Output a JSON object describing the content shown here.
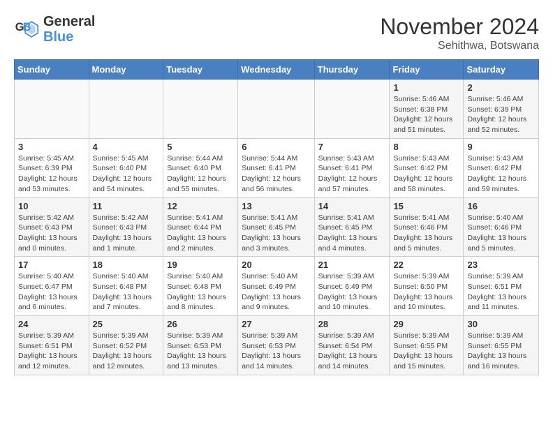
{
  "header": {
    "logo_line1": "General",
    "logo_line2": "Blue",
    "month": "November 2024",
    "location": "Sehithwa, Botswana"
  },
  "weekdays": [
    "Sunday",
    "Monday",
    "Tuesday",
    "Wednesday",
    "Thursday",
    "Friday",
    "Saturday"
  ],
  "weeks": [
    [
      {
        "day": "",
        "info": ""
      },
      {
        "day": "",
        "info": ""
      },
      {
        "day": "",
        "info": ""
      },
      {
        "day": "",
        "info": ""
      },
      {
        "day": "",
        "info": ""
      },
      {
        "day": "1",
        "info": "Sunrise: 5:46 AM\nSunset: 6:38 PM\nDaylight: 12 hours\nand 51 minutes."
      },
      {
        "day": "2",
        "info": "Sunrise: 5:46 AM\nSunset: 6:39 PM\nDaylight: 12 hours\nand 52 minutes."
      }
    ],
    [
      {
        "day": "3",
        "info": "Sunrise: 5:45 AM\nSunset: 6:39 PM\nDaylight: 12 hours\nand 53 minutes."
      },
      {
        "day": "4",
        "info": "Sunrise: 5:45 AM\nSunset: 6:40 PM\nDaylight: 12 hours\nand 54 minutes."
      },
      {
        "day": "5",
        "info": "Sunrise: 5:44 AM\nSunset: 6:40 PM\nDaylight: 12 hours\nand 55 minutes."
      },
      {
        "day": "6",
        "info": "Sunrise: 5:44 AM\nSunset: 6:41 PM\nDaylight: 12 hours\nand 56 minutes."
      },
      {
        "day": "7",
        "info": "Sunrise: 5:43 AM\nSunset: 6:41 PM\nDaylight: 12 hours\nand 57 minutes."
      },
      {
        "day": "8",
        "info": "Sunrise: 5:43 AM\nSunset: 6:42 PM\nDaylight: 12 hours\nand 58 minutes."
      },
      {
        "day": "9",
        "info": "Sunrise: 5:43 AM\nSunset: 6:42 PM\nDaylight: 12 hours\nand 59 minutes."
      }
    ],
    [
      {
        "day": "10",
        "info": "Sunrise: 5:42 AM\nSunset: 6:43 PM\nDaylight: 13 hours\nand 0 minutes."
      },
      {
        "day": "11",
        "info": "Sunrise: 5:42 AM\nSunset: 6:43 PM\nDaylight: 13 hours\nand 1 minute."
      },
      {
        "day": "12",
        "info": "Sunrise: 5:41 AM\nSunset: 6:44 PM\nDaylight: 13 hours\nand 2 minutes."
      },
      {
        "day": "13",
        "info": "Sunrise: 5:41 AM\nSunset: 6:45 PM\nDaylight: 13 hours\nand 3 minutes."
      },
      {
        "day": "14",
        "info": "Sunrise: 5:41 AM\nSunset: 6:45 PM\nDaylight: 13 hours\nand 4 minutes."
      },
      {
        "day": "15",
        "info": "Sunrise: 5:41 AM\nSunset: 6:46 PM\nDaylight: 13 hours\nand 5 minutes."
      },
      {
        "day": "16",
        "info": "Sunrise: 5:40 AM\nSunset: 6:46 PM\nDaylight: 13 hours\nand 5 minutes."
      }
    ],
    [
      {
        "day": "17",
        "info": "Sunrise: 5:40 AM\nSunset: 6:47 PM\nDaylight: 13 hours\nand 6 minutes."
      },
      {
        "day": "18",
        "info": "Sunrise: 5:40 AM\nSunset: 6:48 PM\nDaylight: 13 hours\nand 7 minutes."
      },
      {
        "day": "19",
        "info": "Sunrise: 5:40 AM\nSunset: 6:48 PM\nDaylight: 13 hours\nand 8 minutes."
      },
      {
        "day": "20",
        "info": "Sunrise: 5:40 AM\nSunset: 6:49 PM\nDaylight: 13 hours\nand 9 minutes."
      },
      {
        "day": "21",
        "info": "Sunrise: 5:39 AM\nSunset: 6:49 PM\nDaylight: 13 hours\nand 10 minutes."
      },
      {
        "day": "22",
        "info": "Sunrise: 5:39 AM\nSunset: 6:50 PM\nDaylight: 13 hours\nand 10 minutes."
      },
      {
        "day": "23",
        "info": "Sunrise: 5:39 AM\nSunset: 6:51 PM\nDaylight: 13 hours\nand 11 minutes."
      }
    ],
    [
      {
        "day": "24",
        "info": "Sunrise: 5:39 AM\nSunset: 6:51 PM\nDaylight: 13 hours\nand 12 minutes."
      },
      {
        "day": "25",
        "info": "Sunrise: 5:39 AM\nSunset: 6:52 PM\nDaylight: 13 hours\nand 12 minutes."
      },
      {
        "day": "26",
        "info": "Sunrise: 5:39 AM\nSunset: 6:53 PM\nDaylight: 13 hours\nand 13 minutes."
      },
      {
        "day": "27",
        "info": "Sunrise: 5:39 AM\nSunset: 6:53 PM\nDaylight: 13 hours\nand 14 minutes."
      },
      {
        "day": "28",
        "info": "Sunrise: 5:39 AM\nSunset: 6:54 PM\nDaylight: 13 hours\nand 14 minutes."
      },
      {
        "day": "29",
        "info": "Sunrise: 5:39 AM\nSunset: 6:55 PM\nDaylight: 13 hours\nand 15 minutes."
      },
      {
        "day": "30",
        "info": "Sunrise: 5:39 AM\nSunset: 6:55 PM\nDaylight: 13 hours\nand 16 minutes."
      }
    ]
  ]
}
